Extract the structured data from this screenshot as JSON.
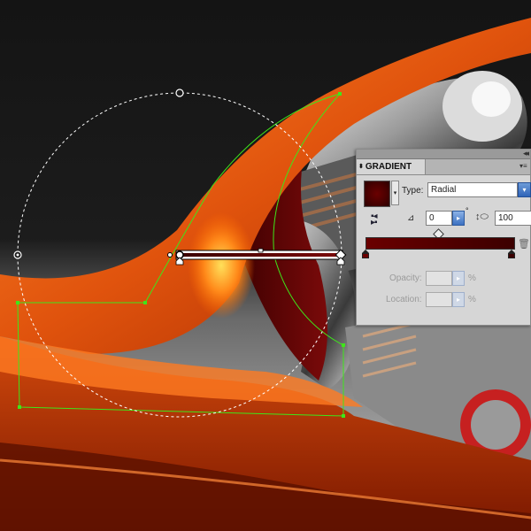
{
  "panel": {
    "tab_title": "GRADIENT",
    "type_label": "Type:",
    "type_value": "Radial",
    "angle_value": "0",
    "degree_symbol": "°",
    "aspect_value": "100",
    "opacity_label": "Opacity:",
    "opacity_unit": "%",
    "location_label": "Location:",
    "location_unit": "%",
    "gradient_colors": [
      "#6a0000",
      "#3c0000"
    ]
  },
  "icons": {
    "collapse": "double-arrow-right-icon",
    "menu": "panel-menu-icon",
    "reverse": "reverse-gradient-icon",
    "angle": "angle-icon",
    "aspect": "aspect-ratio-icon",
    "trash": "trash-icon"
  },
  "colors": {
    "canvas_background": "#1a1a1a",
    "orange": "#e0530d",
    "selection_green": "#3ee61a",
    "panel_bg": "#d6d6d6"
  }
}
